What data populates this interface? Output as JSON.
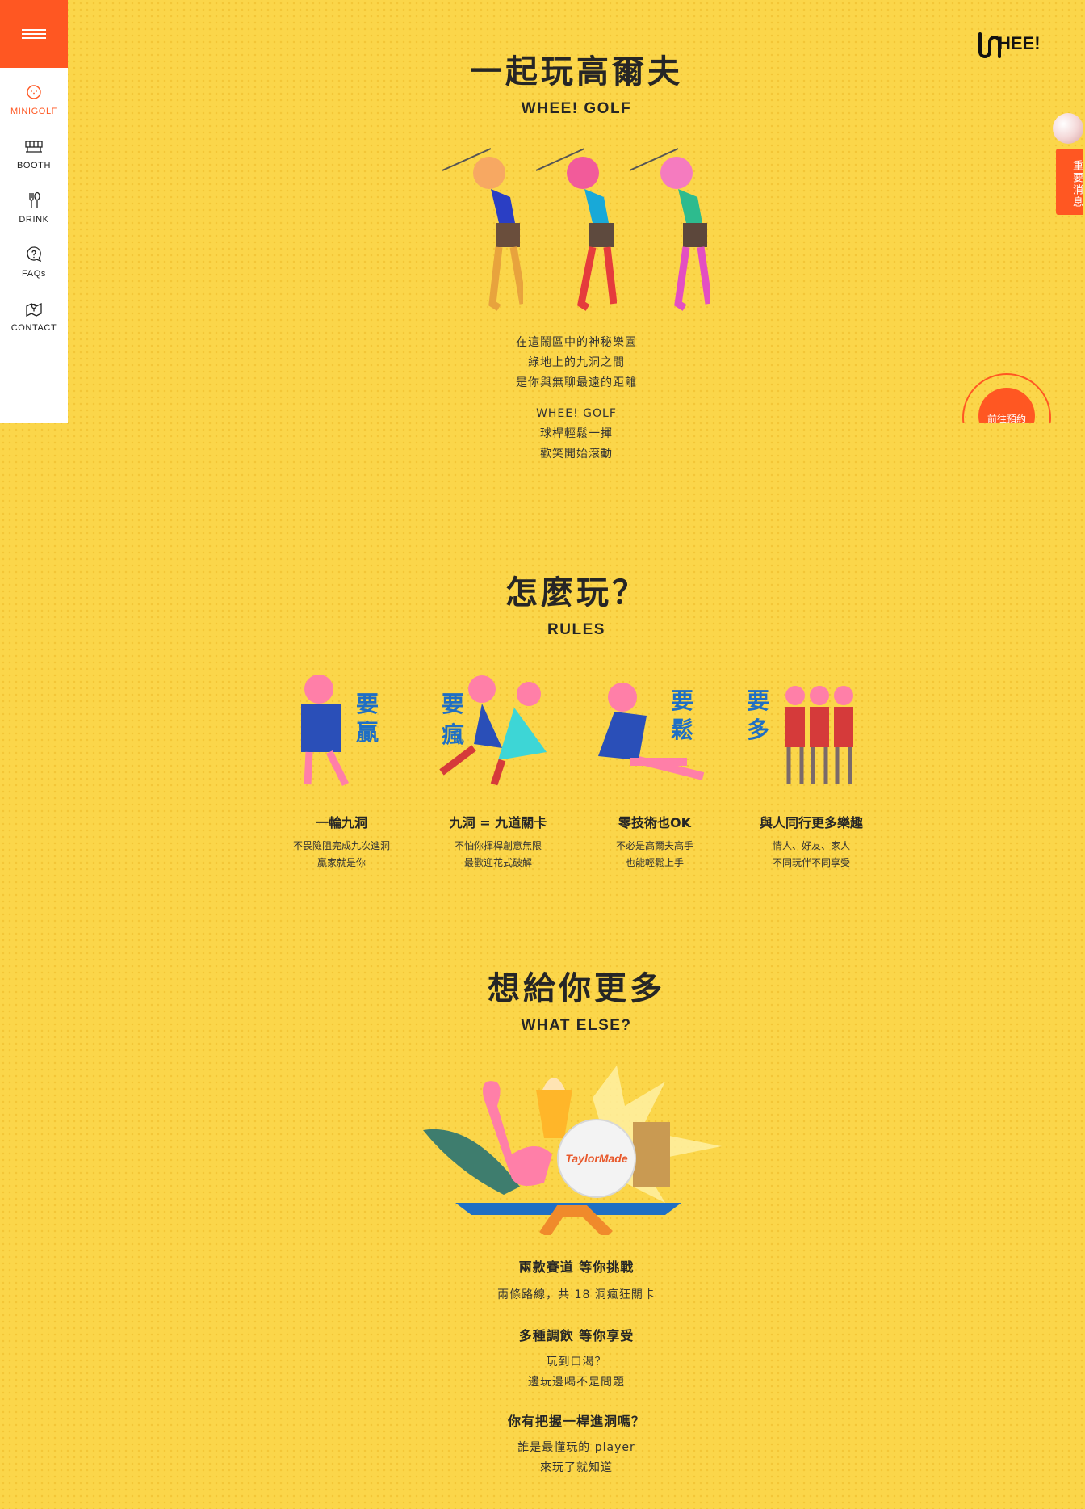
{
  "sidebar": {
    "menu_icon": "hamburger-icon",
    "items": [
      {
        "label": "MINIGOLF",
        "icon": "golf-ball-icon",
        "active": true
      },
      {
        "label": "BOOTH",
        "icon": "booth-icon",
        "active": false
      },
      {
        "label": "DRINK",
        "icon": "cutlery-icon",
        "active": false
      },
      {
        "label": "FAQs",
        "icon": "chat-question-icon",
        "active": false
      },
      {
        "label": "CONTACT",
        "icon": "map-pin-icon",
        "active": false
      }
    ]
  },
  "logo": {
    "text": "WHEE!"
  },
  "notice": {
    "label": "重要消息"
  },
  "booking": {
    "label": "前往預約"
  },
  "intro": {
    "title": "一起玩高爾夫",
    "subtitle": "WHEE! GOLF",
    "para1": [
      "在這鬧區中的神秘樂園",
      "綠地上的九洞之間",
      "是你與無聊最遠的距離"
    ],
    "para2": [
      "WHEE! GOLF",
      "球桿輕鬆一揮",
      "歡笑開始滾動"
    ]
  },
  "rules": {
    "title": "怎麼玩？",
    "subtitle": "RULES",
    "items": [
      {
        "badge": "要贏",
        "title": "一輪九洞",
        "desc": [
          "不畏險阻完成九次進洞",
          "贏家就是你"
        ]
      },
      {
        "badge": "要瘋",
        "title": "九洞 = 九道關卡",
        "desc": [
          "不怕你揮桿創意無限",
          "最歡迎花式破解"
        ]
      },
      {
        "badge": "要鬆",
        "title": "零技術也OK",
        "desc": [
          "不必是高爾夫高手",
          "也能輕鬆上手"
        ]
      },
      {
        "badge": "要多",
        "title": "與人同行更多樂趣",
        "desc": [
          "情人、好友、家人",
          "不同玩伴不同享受"
        ]
      }
    ]
  },
  "more": {
    "title": "想給你更多",
    "subtitle": "WHAT ELSE?",
    "ball_brand": "TaylorMade",
    "blocks": [
      {
        "title": "兩款賽道 等你挑戰",
        "lines": [
          "兩條路線，共 18 洞瘋狂關卡"
        ]
      },
      {
        "title": "多種調飲 等你享受",
        "lines": [
          "玩到口渴？",
          "邊玩邊喝不是問題"
        ]
      },
      {
        "title": "你有把握一桿進洞嗎？",
        "lines": [
          "誰是最懂玩的 player",
          "來玩了就知道"
        ]
      }
    ]
  },
  "colors": {
    "accent": "#ff5722",
    "background": "#fbd64a",
    "badge_blue": "#1f6fc4",
    "head_pink": "#ff7fa8"
  }
}
